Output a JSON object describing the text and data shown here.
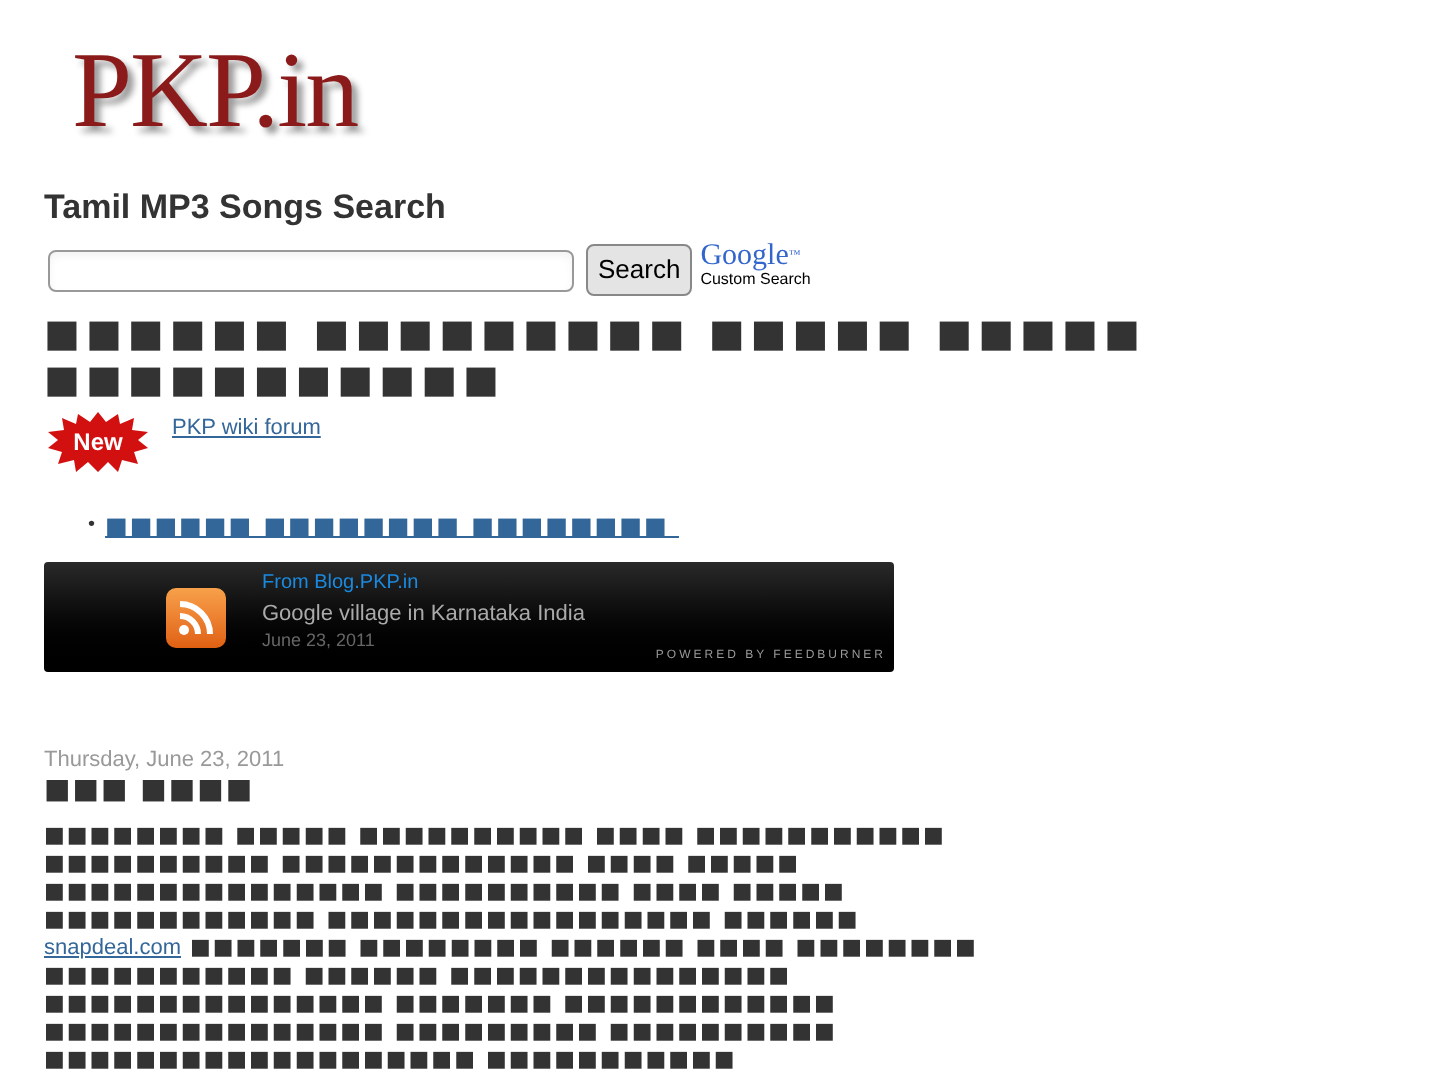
{
  "logo": "PKP.in",
  "search": {
    "title": "Tamil MP3 Songs Search",
    "button": "Search",
    "brand": "Google",
    "brand_mark": "™",
    "brand_caption": "Custom Search"
  },
  "headline": [
    "■■■■■■ ■■■■■■■■■ ■■■■■ ■■■■■",
    "■■■■■■■■■■■"
  ],
  "new_badge": "New",
  "forum_link": "PKP wiki forum",
  "links": [
    {
      "bullet": "•",
      "text": "■■■■■■ ■■■■■■■■ ■■■■■■■■ "
    }
  ],
  "feed": {
    "source": "From Blog.PKP.in",
    "title": "Google village in Karnataka India",
    "date": "June 23, 2011",
    "credit": "POWERED BY FEEDBURNER"
  },
  "post": {
    "date": "Thursday, June 23, 2011",
    "title": "■■■ ■■■■",
    "lines": [
      {
        "text": "■■■■■■■■ ■■■■■ ■■■■■■■■■■ ■■■■ ■■■■■■■■■■■"
      },
      {
        "text": "■■■■■■■■■■ ■■■■■■■■■■■■■ ■■■■ ■■■■■"
      },
      {
        "text": "■■■■■■■■■■■■■■■ ■■■■■■■■■■ ■■■■ ■■■■■"
      },
      {
        "text": "■■■■■■■■■■■■ ■■■■■■■■■■■■■■■■■ ■■■■■■"
      },
      {
        "link": "snapdeal.com",
        "text": " ■■■■■■■ ■■■■■■■■ ■■■■■■ ■■■■ ■■■■■■■■"
      },
      {
        "text": "■■■■■■■■■■■ ■■■■■■ ■■■■■■■■■■■■■■■"
      },
      {
        "text": "■■■■■■■■■■■■■■■ ■■■■■■■ ■■■■■■■■■■■■"
      },
      {
        "text": "■■■■■■■■■■■■■■■ ■■■■■■■■■ ■■■■■■■■■■"
      },
      {
        "text": "■■■■■■■■■■■■■■■■■■■ ■■■■■■■■■■■"
      }
    ]
  }
}
